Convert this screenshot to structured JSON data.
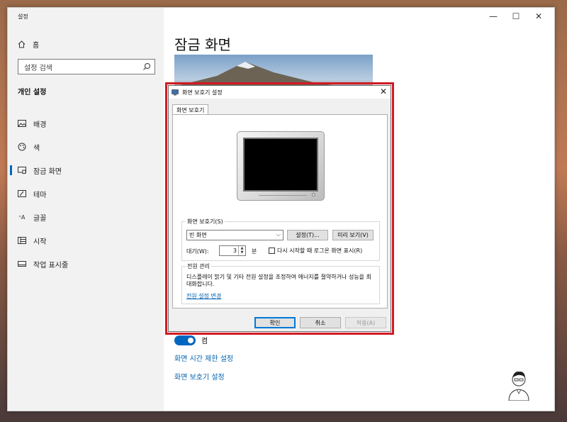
{
  "window": {
    "app_title": "설정",
    "controls": {
      "minimize": "—",
      "maximize": "☐",
      "close": "✕"
    }
  },
  "sidebar": {
    "home_label": "홈",
    "search_placeholder": "설정 검색",
    "section_title": "개인 설정",
    "items": [
      {
        "label": "배경",
        "icon": "background-icon"
      },
      {
        "label": "색",
        "icon": "palette-icon"
      },
      {
        "label": "잠금 화면",
        "icon": "lock-screen-icon",
        "active": true
      },
      {
        "label": "테마",
        "icon": "theme-icon"
      },
      {
        "label": "글꼴",
        "icon": "font-icon"
      },
      {
        "label": "시작",
        "icon": "start-icon"
      },
      {
        "label": "작업 표시줄",
        "icon": "taskbar-icon"
      }
    ]
  },
  "main": {
    "page_title": "잠금 화면",
    "toggle_label": "켬",
    "link_timeout": "화면 시간 제한 설정",
    "link_screensaver": "화면 보호기 설정"
  },
  "dialog": {
    "title": "화면 보호기 설정",
    "close_glyph": "✕",
    "tab_label": "화면 보호기",
    "screensaver_group_label": "화면 보호기(S)",
    "screensaver_selected": "빈 화면",
    "settings_button": "설정(T)...",
    "preview_button": "미리 보기(V)",
    "wait_label": "대기(W):",
    "wait_value": "3",
    "wait_unit": "분",
    "resume_logon_label": "다시 시작할 때 로그온 화면 표시(R)",
    "resume_logon_checked": false,
    "power_group_label": "전원 관리",
    "power_description": "디스플레이 밝기 및 기타 전원 설정을 조정하여 에너지를 절약하거나 성능을 최대화합니다.",
    "power_link": "전원 설정 변경",
    "ok_button": "확인",
    "cancel_button": "취소",
    "apply_button": "적용(A)"
  },
  "colors": {
    "accent": "#0067c0",
    "link": "#0063b1",
    "highlight_border": "#d11b24"
  }
}
